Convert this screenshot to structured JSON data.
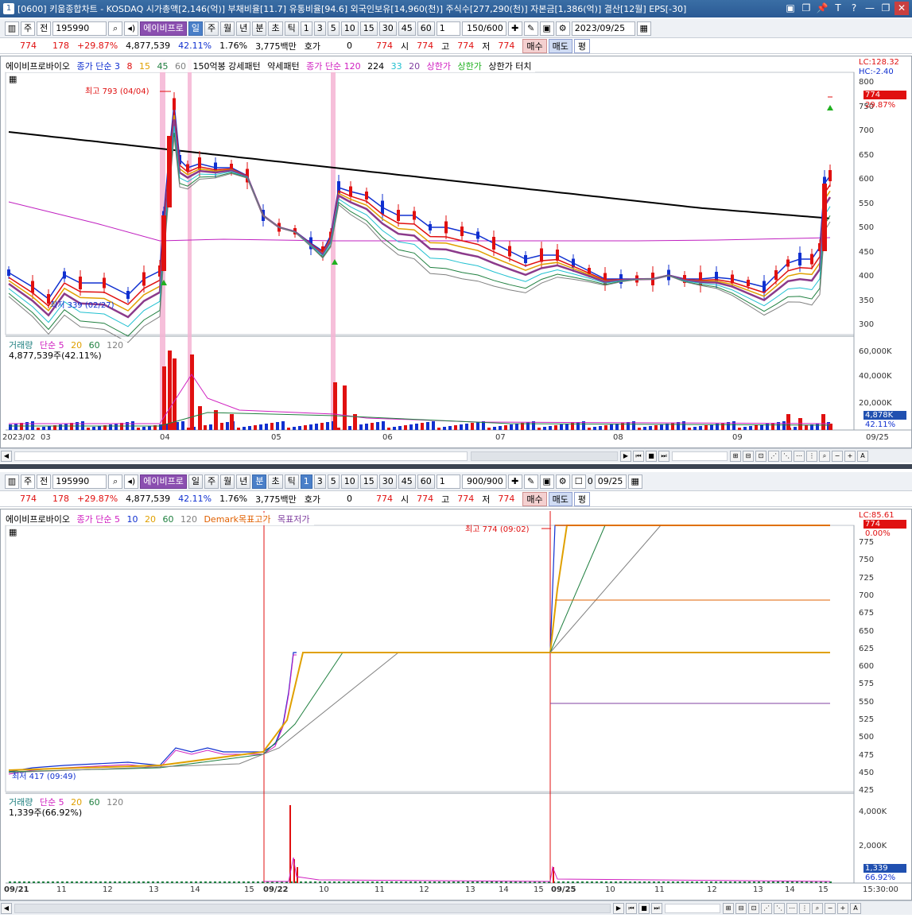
{
  "window": {
    "title": "[0600] 키움종합차트 - KOSDAQ 시가총액[2,146(억)] 부채비율[11.7] 유통비율[94.6] 외국인보유[14,960(천)] 주식수[277,290(천)] 자본금[1,386(억)] 결산[12월] EPS[-30]",
    "icon": "1",
    "buttons": [
      "▣",
      "❐",
      "📌",
      "T",
      "?",
      "—",
      "❐",
      "✕"
    ]
  },
  "top": {
    "toolbar": {
      "mode1": "주",
      "mode2": "전",
      "code": "195990",
      "name": "에이비프로",
      "periods": [
        "일",
        "주",
        "월",
        "년",
        "분",
        "초",
        "틱"
      ],
      "active_period": "일",
      "nums": [
        "1",
        "3",
        "5",
        "10",
        "15",
        "30",
        "45",
        "60"
      ],
      "select_num": "1",
      "range": "150/600",
      "date": "2023/09/25"
    },
    "quote": {
      "price": "774",
      "change": "178",
      "rate": "+29.87%",
      "volume": "4,877,539",
      "vol_ratio": "42.11%",
      "turnover": "1.76%",
      "amount": "3,775백만",
      "hoga_label": "호가",
      "hoga": "0",
      "ask": "774",
      "open_label": "시",
      "open": "774",
      "high_label": "고",
      "high": "774",
      "low_label": "저",
      "low": "774",
      "buy": "매수",
      "sell": "매도",
      "eval": "평"
    },
    "legend": [
      "에이비프로바이오",
      "종가 단순 3",
      "8",
      "15",
      "45",
      "60",
      "150억봉 강세패턴",
      "약세패턴",
      "종가 단순 120",
      "224",
      "33",
      "20",
      "상한가",
      "상한가",
      "상한가 터치"
    ],
    "right_top": [
      "LC:128.32",
      "HC:-2.40"
    ],
    "price_axis": [
      "800",
      "750",
      "700",
      "650",
      "600",
      "550",
      "500",
      "450",
      "400",
      "350",
      "300"
    ],
    "tag_price": "774",
    "tag_rate": "29.87%",
    "high_annot": "최고 793 (04/04)",
    "low_annot": "최저 339 (02/27)",
    "vol_legend": [
      "거래량",
      "단순 5",
      "20",
      "60",
      "120"
    ],
    "vol_value": "4,877,539주(42.11%)",
    "vol_axis": [
      "60,000K",
      "40,000K",
      "20,000K"
    ],
    "vol_tag": "4,878K",
    "vol_tag_rate": "42.11%",
    "xlabels": [
      "2023/02",
      "03",
      "04",
      "05",
      "06",
      "07",
      "08",
      "09",
      "09/25"
    ]
  },
  "bottom": {
    "toolbar": {
      "mode1": "주",
      "mode2": "전",
      "code": "195990",
      "name": "에이비프로",
      "periods": [
        "일",
        "주",
        "월",
        "년",
        "분",
        "초",
        "틱"
      ],
      "active_period": "분",
      "nums": [
        "1",
        "3",
        "5",
        "10",
        "15",
        "30",
        "45",
        "60"
      ],
      "select_num": "1",
      "range": "900/900",
      "checkbox_label": "0",
      "date": "09/25"
    },
    "quote": {
      "price": "774",
      "change": "178",
      "rate": "+29.87%",
      "volume": "4,877,539",
      "vol_ratio": "42.11%",
      "turnover": "1.76%",
      "amount": "3,775백만",
      "hoga_label": "호가",
      "hoga": "0",
      "ask": "774",
      "open_label": "시",
      "open": "774",
      "high_label": "고",
      "high": "774",
      "low_label": "저",
      "low": "774",
      "buy": "매수",
      "sell": "매도",
      "eval": "평"
    },
    "legend": [
      "에이비프로바이오",
      "종가 단순 5",
      "10",
      "20",
      "60",
      "120",
      "Demark목표고가",
      "목표저가"
    ],
    "right_top": [
      "LC:85.61"
    ],
    "price_axis": [
      "775",
      "750",
      "725",
      "700",
      "675",
      "650",
      "625",
      "600",
      "575",
      "550",
      "525",
      "500",
      "475",
      "450",
      "425"
    ],
    "tag_price": "774",
    "tag_rate": "0.00%",
    "high_annot": "최고 774 (09:02)",
    "low_annot": "최저 417 (09:49)",
    "vol_legend": [
      "거래량",
      "단순 5",
      "20",
      "60",
      "120"
    ],
    "vol_value": "1,339주(66.92%)",
    "vol_axis": [
      "4,000K",
      "2,000K"
    ],
    "vol_tag": "1,339",
    "vol_tag_rate": "66.92%",
    "xlabels": [
      "09/21",
      "11",
      "12",
      "13",
      "14",
      "15",
      "09/22",
      "10",
      "11",
      "12",
      "13",
      "14",
      "15",
      "09/25",
      "10",
      "11",
      "12",
      "13",
      "14",
      "15",
      "15:30:00"
    ]
  }
}
